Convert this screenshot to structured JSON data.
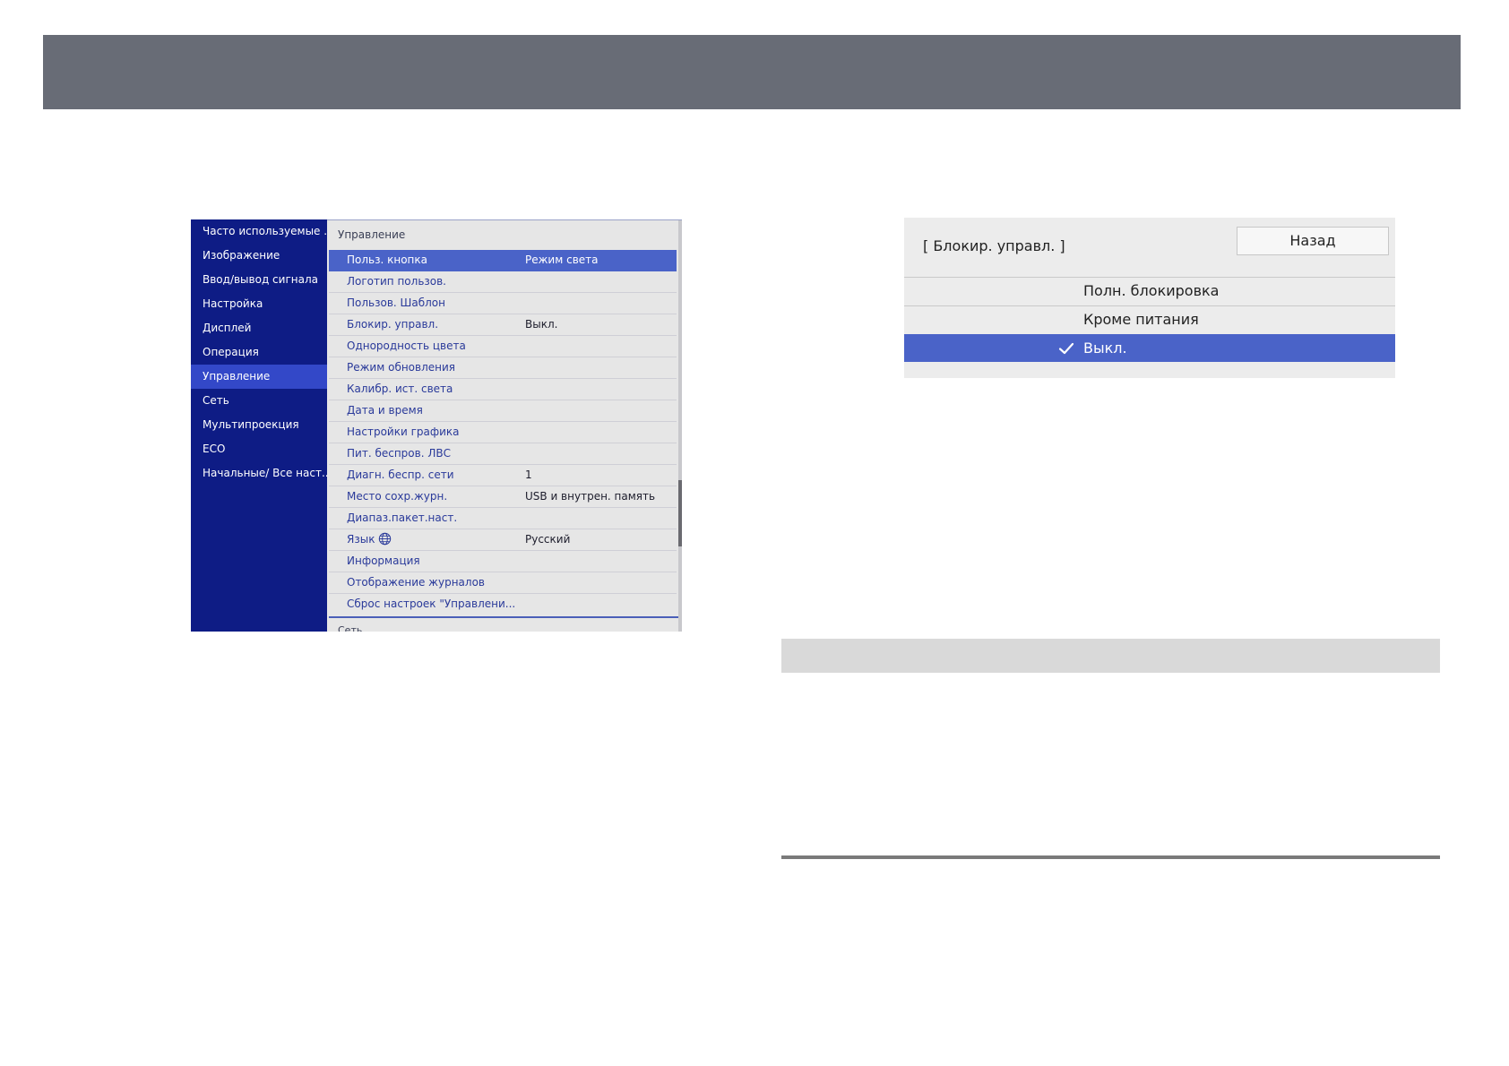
{
  "menu": {
    "sidebar": {
      "items": [
        {
          "label": "Часто используемые ..."
        },
        {
          "label": "Изображение"
        },
        {
          "label": "Ввод/вывод сигнала"
        },
        {
          "label": "Настройка"
        },
        {
          "label": "Дисплей"
        },
        {
          "label": "Операция"
        },
        {
          "label": "Управление",
          "active": true
        },
        {
          "label": "Сеть"
        },
        {
          "label": "Мультипроекция"
        },
        {
          "label": "ECO"
        },
        {
          "label": "Начальные/ Все наст..."
        }
      ]
    },
    "main": {
      "header": "Управление",
      "rows": [
        {
          "label": "Польз. кнопка",
          "value": "Режим света",
          "selected": true
        },
        {
          "label": "Логотип пользов.",
          "value": ""
        },
        {
          "label": "Пользов. Шаблон",
          "value": ""
        },
        {
          "label": "Блокир. управл.",
          "value": "Выкл."
        },
        {
          "label": "Однородность цвета",
          "value": ""
        },
        {
          "label": "Режим обновления",
          "value": ""
        },
        {
          "label": "Калибр. ист. света",
          "value": ""
        },
        {
          "label": "Дата и время",
          "value": ""
        },
        {
          "label": "Настройки графика",
          "value": ""
        },
        {
          "label": "Пит. беспров. ЛВС",
          "value": ""
        },
        {
          "label": "Диагн. беспр. сети",
          "value": "1"
        },
        {
          "label": "Место сохр.журн.",
          "value": "USB и внутрен. память"
        },
        {
          "label": "Диапаз.пакет.наст.",
          "value": ""
        },
        {
          "label": "Язык",
          "value": "Русский",
          "icon": "globe-icon"
        },
        {
          "label": "Информация",
          "value": ""
        },
        {
          "label": "Отображение журналов",
          "value": ""
        },
        {
          "label": "Сброс настроек \"Управлени...",
          "value": ""
        }
      ],
      "next_section": "Сеть"
    }
  },
  "lock_dialog": {
    "title": "[ Блокир. управл. ]",
    "back_label": "Назад",
    "options": [
      {
        "label": "Полн. блокировка",
        "selected": false
      },
      {
        "label": "Кроме питания",
        "selected": false
      },
      {
        "label": "Выкл.",
        "selected": true,
        "icon": "check-icon"
      }
    ]
  },
  "colors": {
    "top_band": "#686c76",
    "sidebar_bg": "#0e1c85",
    "sidebar_active": "#3348c8",
    "selection": "#4a63c8",
    "panel_bg": "#e6e6e6"
  }
}
